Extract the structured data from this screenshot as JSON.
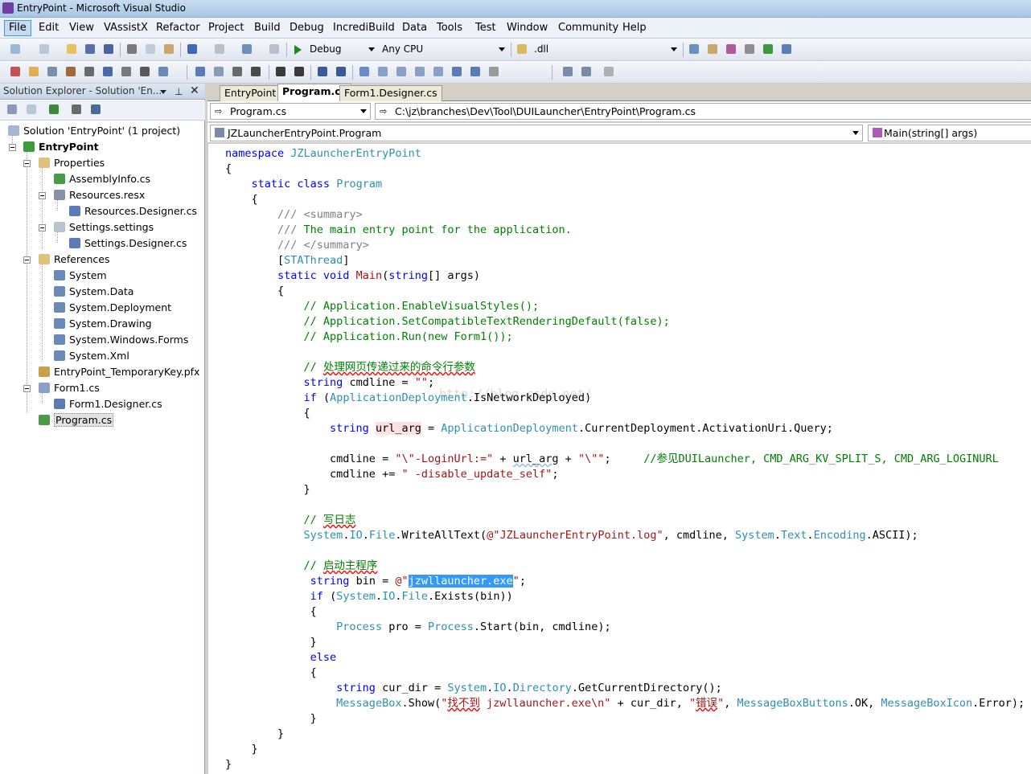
{
  "window": {
    "title": "EntryPoint - Microsoft Visual Studio"
  },
  "menu": [
    "File",
    "Edit",
    "View",
    "VAssistX",
    "Refactor",
    "Project",
    "Build",
    "Debug",
    "IncrediBuild",
    "Data",
    "Tools",
    "Test",
    "Window",
    "Community",
    "Help"
  ],
  "toolbar": {
    "config": "Debug",
    "platform": "Any CPU",
    "find_combo": ".dll"
  },
  "solution_explorer": {
    "title": "Solution Explorer - Solution 'En...",
    "nodes": [
      "Solution 'EntryPoint' (1 project)",
      "EntryPoint",
      "Properties",
      "AssemblyInfo.cs",
      "Resources.resx",
      "Resources.Designer.cs",
      "Settings.settings",
      "Settings.Designer.cs",
      "References",
      "System",
      "System.Data",
      "System.Deployment",
      "System.Drawing",
      "System.Windows.Forms",
      "System.Xml",
      "EntryPoint_TemporaryKey.pfx",
      "Form1.cs",
      "Form1.Designer.cs",
      "Program.cs"
    ],
    "selected": "Program.cs"
  },
  "editor": {
    "tabs": [
      "EntryPoint",
      "Program.cs",
      "Form1.Designer.cs"
    ],
    "active_tab": "Program.cs",
    "file_combo": "Program.cs",
    "path": "C:\\jz\\branches\\Dev\\Tool\\DUILauncher\\EntryPoint\\Program.cs",
    "type_combo": "JZLauncherEntryPoint.Program",
    "member_combo": "Main(string[] args)",
    "watermark": "http://blog.csdn.net/",
    "colors": {
      "keyword": "#0000ff",
      "comment": "#008000",
      "type": "#2b91af",
      "string": "#a31515",
      "selection": "#3399ff"
    }
  }
}
